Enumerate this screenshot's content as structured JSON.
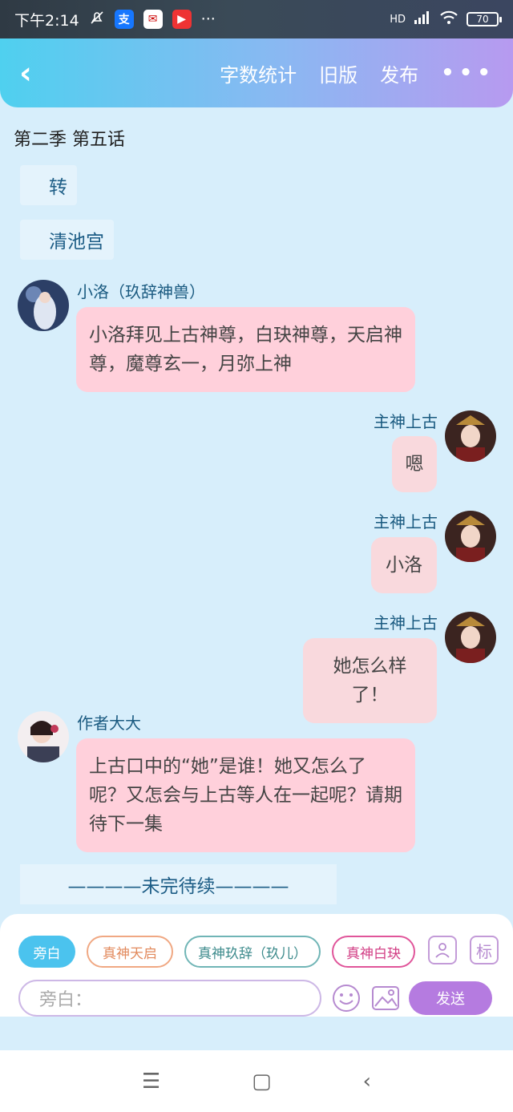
{
  "status_bar": {
    "time": "下午2:14",
    "net": "HD",
    "battery": "70",
    "more": "···"
  },
  "header": {
    "back": "‹",
    "word_count": "字数统计",
    "old_version": "旧版",
    "publish": "发布",
    "more": "•••"
  },
  "chapter_title": "第二季 第五话",
  "narrations": [
    "转",
    "清池宫"
  ],
  "messages": [
    {
      "side": "left",
      "name": "小洛（玖辞神兽）",
      "text": "小洛拜见上古神尊，白玦神尊，天启神尊，魔尊玄一，月弥上神"
    },
    {
      "side": "right",
      "name": "主神上古",
      "text": "嗯"
    },
    {
      "side": "right",
      "name": "主神上古",
      "text": "小洛"
    },
    {
      "side": "right",
      "name": "主神上古",
      "text": "她怎么样了！"
    },
    {
      "side": "left",
      "name": "作者大大",
      "text": "上古口中的“她”是谁！她又怎么了呢？又怎会与上古等人在一起呢？请期待下一集"
    }
  ],
  "ending": "————未完待续————",
  "role_chips": [
    "旁白",
    "真神天启",
    "真神玖辞（玖儿）",
    "真神白玦"
  ],
  "tag_icon": "标",
  "input_placeholder": "旁白：",
  "send_label": "发送",
  "nav": {
    "menu": "☰",
    "home": "▢",
    "back": "‹"
  },
  "colors": {
    "accent": "#4bc3ee",
    "bubble": "#ffd0db",
    "send": "#b57be0"
  }
}
